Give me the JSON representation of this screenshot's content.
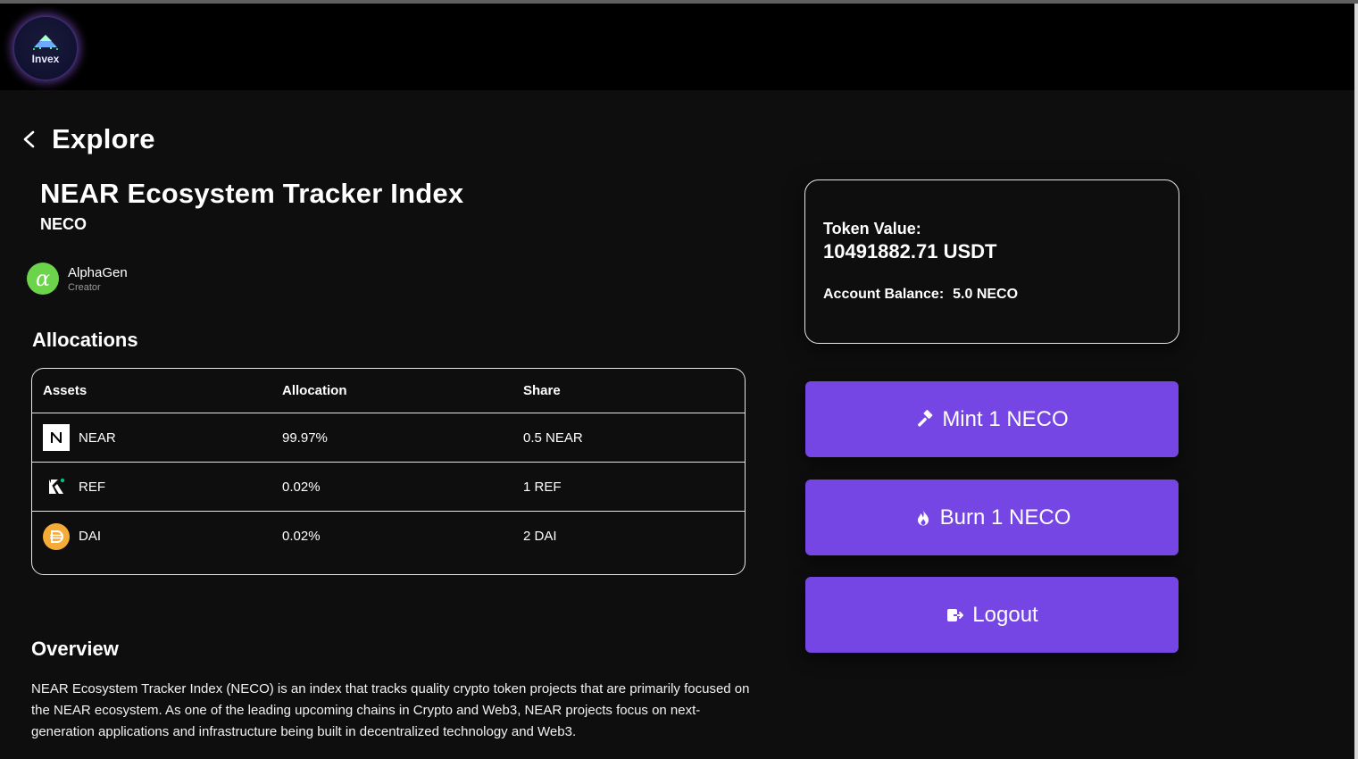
{
  "header": {
    "logo_text": "Invex"
  },
  "nav": {
    "back_title": "Explore"
  },
  "index": {
    "name": "NEAR Ecosystem Tracker Index",
    "symbol": "NECO"
  },
  "creator": {
    "name": "AlphaGen",
    "role": "Creator",
    "avatar_glyph": "α"
  },
  "allocations": {
    "title": "Allocations",
    "headers": [
      "Assets",
      "Allocation",
      "Share"
    ],
    "rows": [
      {
        "asset": "NEAR",
        "allocation": "99.97%",
        "share": "0.5 NEAR",
        "icon": "near-icon"
      },
      {
        "asset": "REF",
        "allocation": "0.02%",
        "share": "1 REF",
        "icon": "ref-icon"
      },
      {
        "asset": "DAI",
        "allocation": "0.02%",
        "share": "2 DAI",
        "icon": "dai-icon"
      }
    ]
  },
  "overview": {
    "title": "Overview",
    "text": "NEAR Ecosystem Tracker Index (NECO) is an index that tracks quality crypto token projects that are primarily focused on the NEAR ecosystem. As one of the leading upcoming chains in Crypto and Web3, NEAR projects focus on next-generation applications and infrastructure being built in decentralized technology and Web3."
  },
  "token": {
    "value_label": "Token Value:",
    "value": "10491882.71 USDT",
    "balance_label": "Account Balance:",
    "balance": "5.0 NECO"
  },
  "actions": {
    "mint_label": "Mint 1 NECO",
    "burn_label": "Burn 1 NECO",
    "logout_label": "Logout"
  },
  "colors": {
    "accent": "#7546e3",
    "background": "#0e0e0e",
    "header": "#000000",
    "dai": "#f5ac37",
    "alphagen": "#6bd44a"
  }
}
